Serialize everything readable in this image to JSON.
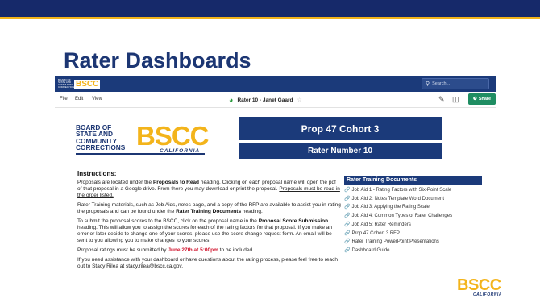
{
  "slide": {
    "title": "Rater Dashboards"
  },
  "nav": {
    "logo_small": "BOARD OF STATE AND COMMUNITY CORRECTIONS",
    "logo_big": "BSCC",
    "search_placeholder": "Search..."
  },
  "toolbar": {
    "menu": [
      "File",
      "Edit",
      "View"
    ],
    "doc_title": "Rater 10 - Janet Gaard",
    "share_label": "Share"
  },
  "logo": {
    "words": [
      "BOARD OF",
      "STATE AND",
      "COMMUNITY",
      "CORRECTIONS"
    ],
    "letters": "BSCC",
    "state": "CALIFORNIA"
  },
  "banners": {
    "cohort": "Prop 47 Cohort 3",
    "rater": "Rater Number 10"
  },
  "instructions": {
    "heading": "Instructions:",
    "p1_a": "Proposals are located under the ",
    "p1_b": "Proposals to Read",
    "p1_c": " heading. Clicking on each proposal name will open the pdf of that proposal in a Google drive. From there you may download or print the proposal. ",
    "p1_d": "Proposals must be read in the order listed.",
    "p2_a": "Rater Training materials, such as Job Aids, notes page, and a copy of the RFP are available to assist you in rating the proposals and can be found under the ",
    "p2_b": "Rater Training Documents",
    "p2_c": " heading.",
    "p3_a": "To submit the proposal scores to the BSCC, click on the proposal name in the ",
    "p3_b": "Proposal Score Submission",
    "p3_c": " heading. This will allow you to assign the scores for each of the rating factors for that proposal. If you make an error or later decide to change one of your scores, please use the score change request form. An email will be sent to you allowing you to make changes to your scores.",
    "p4_a": "Proposal ratings must be submitted by ",
    "p4_b": "June 27th at 5:00pm",
    "p4_c": " to be included.",
    "p5": "If you need assistance with your dashboard or have questions about the rating process, please feel free to reach out to Stacy Rilea at stacy.rilea@bscc.ca.gov."
  },
  "training": {
    "heading": "Rater Training Documents",
    "items": [
      "Job Aid 1 - Rating Factors with Six-Point Scale",
      "Job Aid 2: Notes Template Word Document",
      "Job Aid 3: Applying the Rating Scale",
      "Job Aid 4: Common Types of Rater Challenges",
      "Job Aid 5: Rater Reminders",
      "Prop 47 Cohort 3 RFP",
      "Rater Training PowerPoint Presentations",
      "Dashboard Guide"
    ]
  },
  "corner_logo": {
    "big": "BSCC",
    "sub": "CALIFORNIA"
  },
  "colors": {
    "navy": "#1b3a7a",
    "gold": "#f3b41b",
    "deadline_red": "#d0102a",
    "share_green": "#1f8d62"
  }
}
